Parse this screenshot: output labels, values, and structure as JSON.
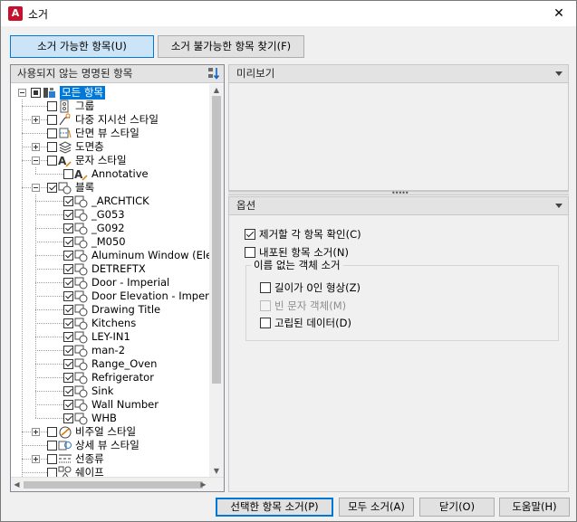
{
  "window": {
    "title": "소거",
    "close": "✕"
  },
  "tabs": [
    {
      "label": "소거 가능한 항목(U)",
      "active": true
    },
    {
      "label": "소거 불가능한 항목 찾기(F)",
      "active": false
    }
  ],
  "tree_panel": {
    "header": "사용되지 않는 명명된 항목"
  },
  "tree": [
    {
      "label": "모든 항목",
      "level": 0,
      "expander": "minus",
      "check": "partial",
      "icon": "all-items-icon",
      "selected": true
    },
    {
      "label": "그룹",
      "level": 1,
      "expander": "",
      "check": "none",
      "icon": "group-icon"
    },
    {
      "label": "다중 지시선 스타일",
      "level": 1,
      "expander": "plus",
      "check": "none",
      "icon": "multileader-style-icon"
    },
    {
      "label": "단면 뷰 스타일",
      "level": 1,
      "expander": "",
      "check": "none",
      "icon": "section-view-style-icon"
    },
    {
      "label": "도면층",
      "level": 1,
      "expander": "plus",
      "check": "none",
      "icon": "layer-icon"
    },
    {
      "label": "문자 스타일",
      "level": 1,
      "expander": "minus",
      "check": "none",
      "icon": "text-style-icon"
    },
    {
      "label": "Annotative",
      "level": 2,
      "expander": "",
      "check": "none",
      "icon": "text-style-icon"
    },
    {
      "label": "블록",
      "level": 1,
      "expander": "minus",
      "check": "checked",
      "icon": "block-icon"
    },
    {
      "label": "_ARCHTICK",
      "level": 2,
      "expander": "",
      "check": "checked",
      "icon": "block-icon"
    },
    {
      "label": "_G053",
      "level": 2,
      "expander": "",
      "check": "checked",
      "icon": "block-icon"
    },
    {
      "label": "_G092",
      "level": 2,
      "expander": "",
      "check": "checked",
      "icon": "block-icon"
    },
    {
      "label": "_M050",
      "level": 2,
      "expander": "",
      "check": "checked",
      "icon": "block-icon"
    },
    {
      "label": "Aluminum Window (Elev",
      "level": 2,
      "expander": "",
      "check": "checked",
      "icon": "block-icon"
    },
    {
      "label": "DETREFTX",
      "level": 2,
      "expander": "",
      "check": "checked",
      "icon": "block-icon"
    },
    {
      "label": "Door - Imperial",
      "level": 2,
      "expander": "",
      "check": "checked",
      "icon": "block-icon"
    },
    {
      "label": "Door Elevation - Imperia",
      "level": 2,
      "expander": "",
      "check": "checked",
      "icon": "block-icon"
    },
    {
      "label": "Drawing Title",
      "level": 2,
      "expander": "",
      "check": "checked",
      "icon": "block-icon"
    },
    {
      "label": "Kitchens",
      "level": 2,
      "expander": "",
      "check": "checked",
      "icon": "block-icon"
    },
    {
      "label": "LEY-IN1",
      "level": 2,
      "expander": "",
      "check": "checked",
      "icon": "block-icon"
    },
    {
      "label": "man-2",
      "level": 2,
      "expander": "",
      "check": "checked",
      "icon": "block-icon"
    },
    {
      "label": "Range_Oven",
      "level": 2,
      "expander": "",
      "check": "checked",
      "icon": "block-icon"
    },
    {
      "label": "Refrigerator",
      "level": 2,
      "expander": "",
      "check": "checked",
      "icon": "block-icon"
    },
    {
      "label": "Sink",
      "level": 2,
      "expander": "",
      "check": "checked",
      "icon": "block-icon"
    },
    {
      "label": "Wall Number",
      "level": 2,
      "expander": "",
      "check": "checked",
      "icon": "block-icon"
    },
    {
      "label": "WHB",
      "level": 2,
      "expander": "",
      "check": "checked",
      "icon": "block-icon"
    },
    {
      "label": "비주얼 스타일",
      "level": 1,
      "expander": "plus",
      "check": "none",
      "icon": "visual-style-icon"
    },
    {
      "label": "상세 뷰 스타일",
      "level": 1,
      "expander": "",
      "check": "none",
      "icon": "detail-view-style-icon"
    },
    {
      "label": "선종류",
      "level": 1,
      "expander": "plus",
      "check": "none",
      "icon": "linetype-icon"
    },
    {
      "label": "쉐이프",
      "level": 1,
      "expander": "",
      "check": "none",
      "icon": "shape-icon"
    }
  ],
  "preview_panel": {
    "header": "미리보기"
  },
  "options_panel": {
    "header": "옵션",
    "confirm": {
      "label": "제거할 각 항목 확인(C)",
      "checked": true
    },
    "nested": {
      "label": "내포된 항목 소거(N)",
      "checked": false
    },
    "unnamed_group": "이름 없는 객체 소거",
    "zero_length": {
      "label": "길이가 0인 형상(Z)",
      "checked": false
    },
    "empty_text": {
      "label": "빈 문자 객체(M)",
      "checked": false,
      "disabled": true
    },
    "orphaned": {
      "label": "고립된 데이터(D)",
      "checked": false
    }
  },
  "buttons": {
    "purge_selected": "선택한 항목 소거(P)",
    "purge_all": "모두 소거(A)",
    "close": "닫기(O)",
    "help": "도움말(H)"
  }
}
